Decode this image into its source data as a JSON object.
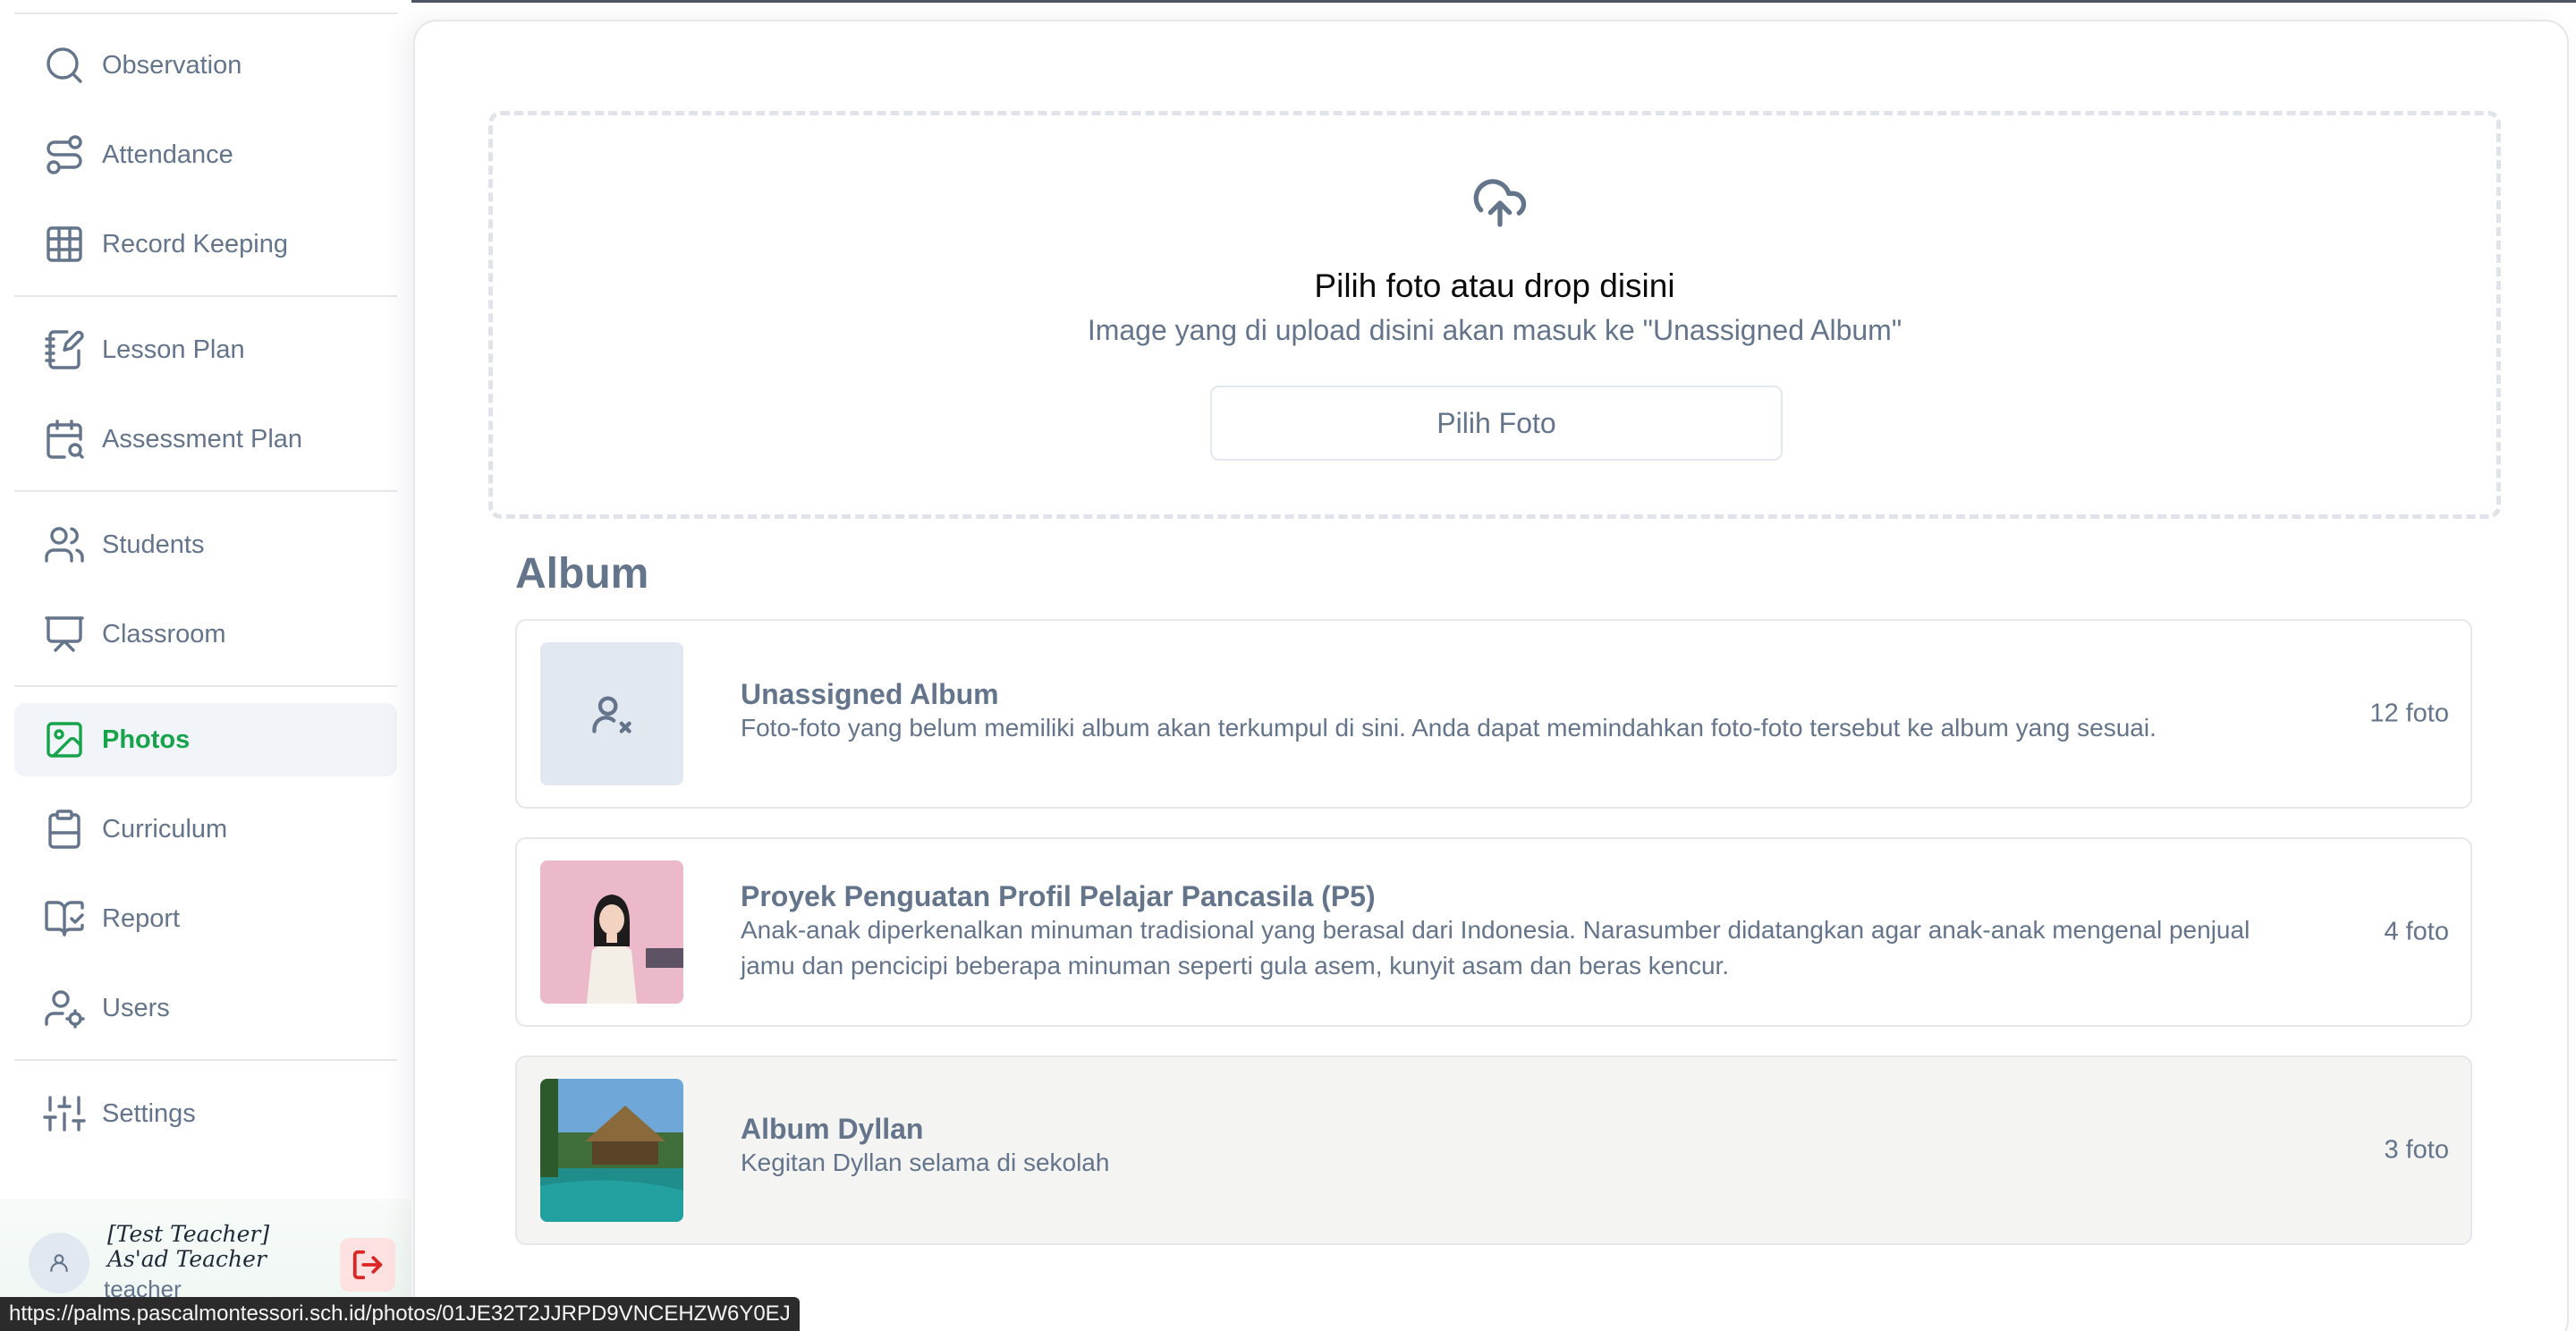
{
  "sidebar": {
    "items": [
      {
        "label": "Observation",
        "icon": "search-icon"
      },
      {
        "label": "Attendance",
        "icon": "route-icon"
      },
      {
        "label": "Record Keeping",
        "icon": "grid-icon"
      },
      {
        "label": "Lesson Plan",
        "icon": "notebook-pen-icon"
      },
      {
        "label": "Assessment Plan",
        "icon": "calendar-search-icon"
      },
      {
        "label": "Students",
        "icon": "users-icon"
      },
      {
        "label": "Classroom",
        "icon": "presentation-icon"
      },
      {
        "label": "Photos",
        "icon": "image-icon",
        "active": true
      },
      {
        "label": "Curriculum",
        "icon": "clipboard-icon"
      },
      {
        "label": "Report",
        "icon": "book-open-check-icon"
      },
      {
        "label": "Users",
        "icon": "user-cog-icon"
      },
      {
        "label": "Settings",
        "icon": "sliders-icon"
      }
    ],
    "user": {
      "name": "[Test Teacher] As'ad Teacher",
      "role": "teacher"
    }
  },
  "upload": {
    "title": "Pilih foto atau drop disini",
    "subtitle": "Image yang di upload disini akan masuk ke \"Unassigned Album\"",
    "button_label": "Pilih Foto"
  },
  "albums": {
    "heading": "Album",
    "items": [
      {
        "title": "Unassigned Album",
        "description": "Foto-foto yang belum memiliki album akan terkumpul di sini. Anda dapat memindahkan foto-foto tersebut ke album yang sesuai.",
        "count": "12 foto",
        "thumb": "user-x-icon"
      },
      {
        "title": "Proyek Penguatan Profil Pelajar Pancasila (P5)",
        "description": "Anak-anak diperkenalkan minuman tradisional yang berasal dari Indonesia. Narasumber didatangkan agar anak-anak mengenal penjual jamu dan pencicipi beberapa minuman seperti gula asem, kunyit asam dan beras kencur.",
        "count": "4 foto",
        "thumb": "photo-girl"
      },
      {
        "title": "Album Dyllan",
        "description": "Kegitan Dyllan selama di sekolah",
        "count": "3 foto",
        "thumb": "photo-resort"
      }
    ]
  },
  "status_bar": {
    "url": "https://palms.pascalmontessori.sch.id/photos/01JE32T2JJRPD9VNCEHZW6Y0EJ"
  },
  "colors": {
    "accent": "#16a34a",
    "text_muted": "#64748b",
    "logout": "#dc2626"
  }
}
